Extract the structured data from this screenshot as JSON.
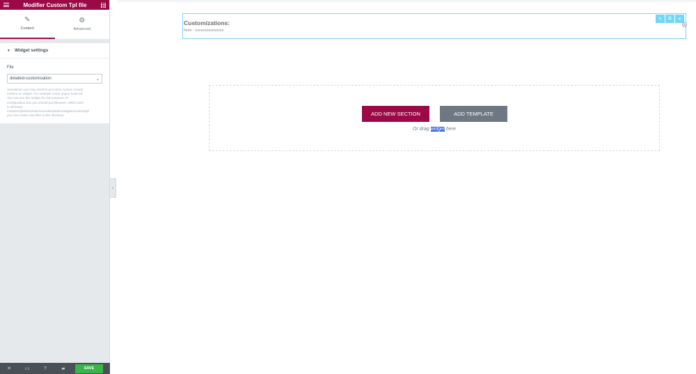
{
  "panel": {
    "title": "Modifier Custom Tpl file",
    "tabs": [
      {
        "label": "Content",
        "icon": "pencil-icon"
      },
      {
        "label": "Advanced",
        "icon": "gear-icon"
      }
    ],
    "section_title": "Widget settings",
    "field_label": "File",
    "select_value": "detailed-customisation",
    "help_lines": [
      "Sometimes you may need to put some custom smarty",
      "content as widget. For example some ungue hook etc",
      "You can use this widget for that purpose. In",
      "configuration box you should put filename, which exist",
      "in directory",
      "modules/iqitelementor/views/templates/widgets/customtpl/",
      "you can create own files in this directory"
    ],
    "footer": {
      "save_label": "SAVE"
    },
    "accent_color": "#9b0a46",
    "save_color": "#39b54a"
  },
  "canvas": {
    "widget": {
      "heading": "Customizations:",
      "line": "Nom : xxxxxxxxxxxxxxx"
    },
    "dropzone": {
      "add_section_label": "ADD NEW SECTION",
      "add_template_label": "ADD TEMPLATE",
      "hint_before": "Or drag ",
      "hint_highlight": "widget",
      "hint_after": " here"
    },
    "widget_border_color": "#71d7f7"
  }
}
